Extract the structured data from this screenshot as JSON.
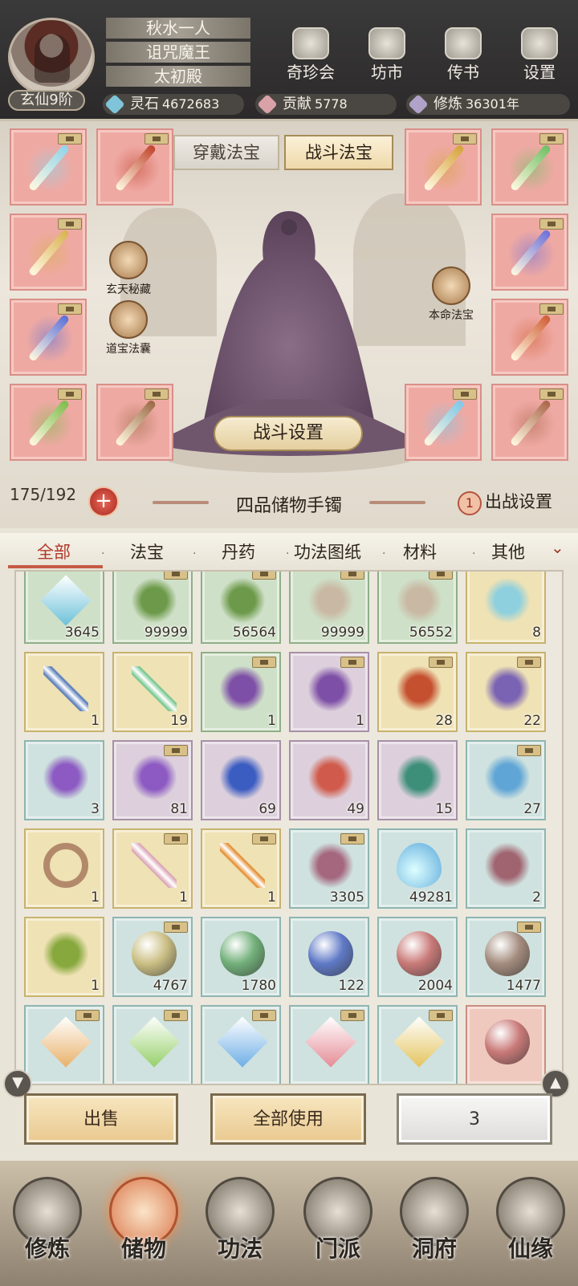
{
  "player": {
    "name": "秋水一人",
    "title": "诅咒魔王",
    "sect": "太初殿",
    "rank": "玄仙9阶"
  },
  "header_buttons": [
    {
      "label": "奇珍会",
      "icon": "treasure-pavilion-icon"
    },
    {
      "label": "坊市",
      "icon": "market-icon"
    },
    {
      "label": "传书",
      "icon": "scroll-letter-icon"
    },
    {
      "label": "设置",
      "icon": "gear-icon"
    }
  ],
  "resources": [
    {
      "label": "灵石",
      "value": "4672683",
      "color": "#7fc4d8"
    },
    {
      "label": "贡献",
      "value": "5778",
      "color": "#d9a1a8"
    },
    {
      "label": "修炼",
      "value": "36301年",
      "color": "#b0a2c9"
    }
  ],
  "equip_tabs": {
    "wear": "穿戴法宝",
    "battle": "战斗法宝"
  },
  "side_buttons": {
    "left1": "玄天秘藏",
    "left2": "道宝法囊",
    "right1": "本命法宝"
  },
  "battle_settings": "战斗设置",
  "bag": {
    "capacity": "175/192",
    "name": "四品储物手镯",
    "deploy_count": "1",
    "deploy_label": "出战设置"
  },
  "categories": [
    "全部",
    "法宝",
    "丹药",
    "功法图纸",
    "材料",
    "其他"
  ],
  "items": [
    {
      "count": "3645",
      "tier": "green",
      "icon": "blue-crystal-icon",
      "lock": false
    },
    {
      "count": "99999",
      "tier": "green",
      "icon": "herb-leaf-icon",
      "lock": true
    },
    {
      "count": "56564",
      "tier": "green",
      "icon": "herb-leaf-icon",
      "lock": true
    },
    {
      "count": "99999",
      "tier": "green",
      "icon": "stone-ore-icon",
      "lock": true
    },
    {
      "count": "56552",
      "tier": "green",
      "icon": "stone-ore-icon",
      "lock": true
    },
    {
      "count": "8",
      "tier": "yellow",
      "icon": "jade-bowl-icon",
      "lock": false
    },
    {
      "count": "1",
      "tier": "yellow",
      "icon": "blue-feather-icon",
      "lock": false
    },
    {
      "count": "19",
      "tier": "yellow",
      "icon": "jade-sword-icon",
      "lock": false
    },
    {
      "count": "1",
      "tier": "green",
      "icon": "purple-beans-icon",
      "lock": true
    },
    {
      "count": "1",
      "tier": "purple",
      "icon": "purple-beans-icon",
      "lock": true
    },
    {
      "count": "28",
      "tier": "yellow",
      "icon": "treasure-chest-icon",
      "lock": true
    },
    {
      "count": "22",
      "tier": "yellow",
      "icon": "purple-spirit-icon",
      "lock": true
    },
    {
      "count": "3",
      "tier": "teal",
      "icon": "purple-flower-icon",
      "lock": false
    },
    {
      "count": "81",
      "tier": "purple",
      "icon": "purple-flower-icon",
      "lock": true
    },
    {
      "count": "69",
      "tier": "purple",
      "icon": "blue-flower-icon",
      "lock": false
    },
    {
      "count": "49",
      "tier": "purple",
      "icon": "red-flower-icon",
      "lock": false
    },
    {
      "count": "15",
      "tier": "purple",
      "icon": "green-flower-icon",
      "lock": false
    },
    {
      "count": "27",
      "tier": "teal",
      "icon": "blue-scroll-icon",
      "lock": true
    },
    {
      "count": "1",
      "tier": "yellow",
      "icon": "ring-icon",
      "lock": false
    },
    {
      "count": "1",
      "tier": "yellow",
      "icon": "pink-sword-icon",
      "lock": true
    },
    {
      "count": "1",
      "tier": "yellow",
      "icon": "flame-sword-icon",
      "lock": true
    },
    {
      "count": "3305",
      "tier": "teal",
      "icon": "dust-pile-icon",
      "lock": true
    },
    {
      "count": "49281",
      "tier": "teal",
      "icon": "water-drop-icon",
      "lock": false
    },
    {
      "count": "2",
      "tier": "teal",
      "icon": "talisman-icon",
      "lock": false
    },
    {
      "count": "1",
      "tier": "yellow",
      "icon": "green-slime-icon",
      "lock": false
    },
    {
      "count": "4767",
      "tier": "teal",
      "icon": "yellow-orb-icon",
      "lock": true
    },
    {
      "count": "1780",
      "tier": "teal",
      "icon": "green-orb-icon",
      "lock": false
    },
    {
      "count": "122",
      "tier": "teal",
      "icon": "blue-orb-icon",
      "lock": false
    },
    {
      "count": "2004",
      "tier": "teal",
      "icon": "red-orb-icon",
      "lock": false
    },
    {
      "count": "1477",
      "tier": "teal",
      "icon": "brown-orb-icon",
      "lock": true
    },
    {
      "count": "",
      "tier": "teal",
      "icon": "orange-gem-icon",
      "lock": true
    },
    {
      "count": "",
      "tier": "teal",
      "icon": "green-gem-icon",
      "lock": true
    },
    {
      "count": "",
      "tier": "teal",
      "icon": "blue-gem-icon",
      "lock": true
    },
    {
      "count": "",
      "tier": "teal",
      "icon": "pink-gem-icon",
      "lock": true
    },
    {
      "count": "",
      "tier": "teal",
      "icon": "yellow-gem-icon",
      "lock": true
    },
    {
      "count": "",
      "tier": "red",
      "icon": "red-orb-icon",
      "lock": false
    }
  ],
  "item_colors": {
    "blue-crystal-icon": "#6cc1d9",
    "herb-leaf-icon": "#6d9a4a",
    "stone-ore-icon": "#c9b9a4",
    "jade-bowl-icon": "#8fd0de",
    "blue-feather-icon": "#4f76b8",
    "jade-sword-icon": "#6fc58c",
    "purple-beans-icon": "#7e4fa6",
    "treasure-chest-icon": "#c4502f",
    "purple-spirit-icon": "#7b63b4",
    "purple-flower-icon": "#8c5ac2",
    "blue-flower-icon": "#3b5cc1",
    "red-flower-icon": "#d05a4b",
    "green-flower-icon": "#3e8f7a",
    "blue-scroll-icon": "#5fa5d6",
    "ring-icon": "#b28a6b",
    "pink-sword-icon": "#d9a1b4",
    "flame-sword-icon": "#e38a2a",
    "dust-pile-icon": "#a5677d",
    "water-drop-icon": "#59a6da",
    "talisman-icon": "#a06470",
    "green-slime-icon": "#86a83d",
    "yellow-orb-icon": "#cbbf84",
    "green-orb-icon": "#72b07a",
    "blue-orb-icon": "#5f79c6",
    "red-orb-icon": "#c97a78",
    "brown-orb-icon": "#a48c7e",
    "orange-gem-icon": "#e9b16a",
    "green-gem-icon": "#96d06a",
    "blue-gem-icon": "#6eaee6",
    "pink-gem-icon": "#e58c97",
    "yellow-gem-icon": "#e4c45d"
  },
  "actions": {
    "sell": "出售",
    "use_all": "全部使用",
    "quantity": "3"
  },
  "nav": [
    {
      "label": "修炼",
      "icon": "meditation-icon"
    },
    {
      "label": "储物",
      "icon": "storage-bag-icon"
    },
    {
      "label": "功法",
      "icon": "scroll-book-icon"
    },
    {
      "label": "门派",
      "icon": "sect-gate-icon"
    },
    {
      "label": "洞府",
      "icon": "cave-mansion-icon"
    },
    {
      "label": "仙缘",
      "icon": "immortal-fate-icon"
    }
  ],
  "equip_slots": [
    {
      "color": "#8fd3ea"
    },
    {
      "color": "#c0432c"
    },
    {
      "color": "#d6a23c"
    },
    {
      "color": "#6fbf63"
    },
    {
      "color": "#d9b252"
    },
    {
      "color": "#6c6fd8"
    },
    {
      "color": "#5a6fd8"
    },
    {
      "color": "#d05d34"
    },
    {
      "color": "#7ebc4c"
    },
    {
      "color": "#9a6a44"
    },
    {
      "color": "#7fc7e8"
    },
    {
      "color": "#a9654a"
    }
  ]
}
